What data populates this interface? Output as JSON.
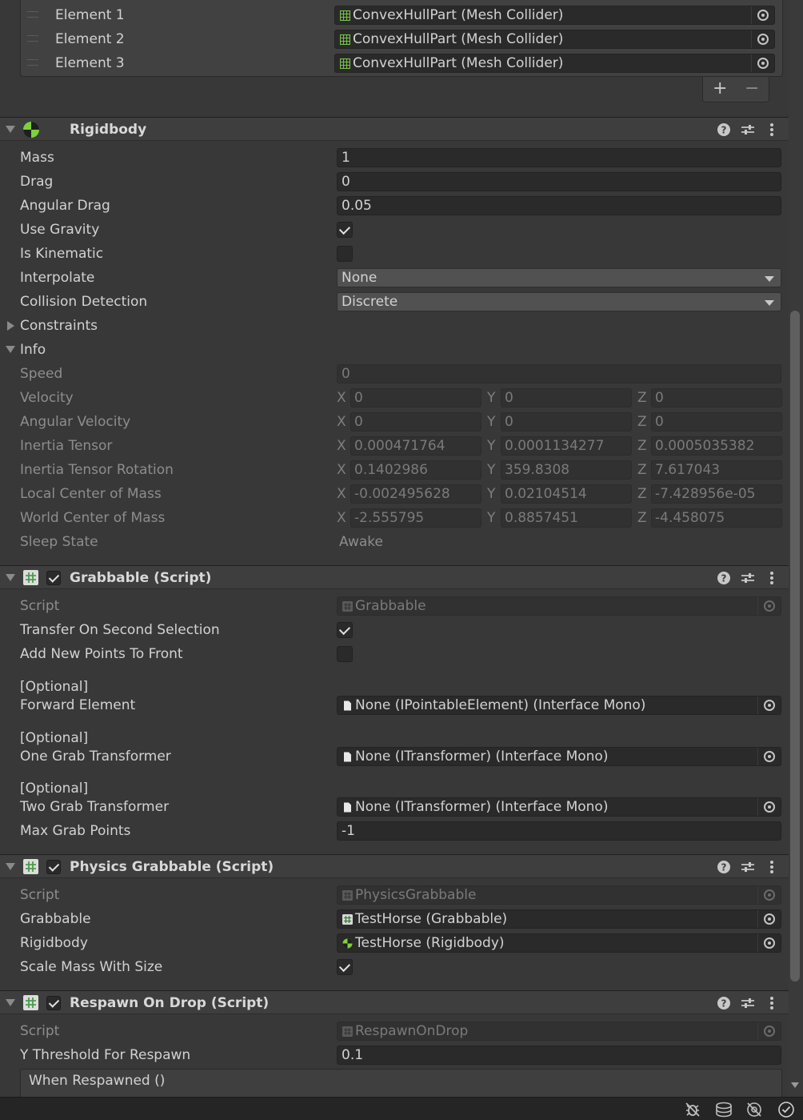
{
  "collider_list": {
    "elements": [
      {
        "label": "Element 1",
        "value": "ConvexHullPart (Mesh Collider)"
      },
      {
        "label": "Element 2",
        "value": "ConvexHullPart (Mesh Collider)"
      },
      {
        "label": "Element 3",
        "value": "ConvexHullPart (Mesh Collider)"
      }
    ],
    "add_label": "+",
    "remove_label": "−"
  },
  "rigidbody": {
    "title": "Rigidbody",
    "mass_label": "Mass",
    "mass": "1",
    "drag_label": "Drag",
    "drag": "0",
    "angular_drag_label": "Angular Drag",
    "angular_drag": "0.05",
    "use_gravity_label": "Use Gravity",
    "use_gravity": true,
    "is_kinematic_label": "Is Kinematic",
    "is_kinematic": false,
    "interpolate_label": "Interpolate",
    "interpolate": "None",
    "collision_label": "Collision Detection",
    "collision": "Discrete",
    "constraints_label": "Constraints",
    "info_label": "Info",
    "info": {
      "speed_label": "Speed",
      "speed": "0",
      "velocity_label": "Velocity",
      "velocity": {
        "x": "0",
        "y": "0",
        "z": "0"
      },
      "angular_velocity_label": "Angular Velocity",
      "angular_velocity": {
        "x": "0",
        "y": "0",
        "z": "0"
      },
      "inertia_tensor_label": "Inertia Tensor",
      "inertia_tensor": {
        "x": "0.000471764",
        "y": "0.0001134277",
        "z": "0.0005035382"
      },
      "inertia_rotation_label": "Inertia Tensor Rotation",
      "inertia_rotation": {
        "x": "0.1402986",
        "y": "359.8308",
        "z": "7.617043"
      },
      "local_com_label": "Local Center of Mass",
      "local_com": {
        "x": "-0.002495628",
        "y": "0.02104514",
        "z": "-7.428956e-05"
      },
      "world_com_label": "World Center of Mass",
      "world_com": {
        "x": "-2.555795",
        "y": "0.8857451",
        "z": "-4.458075"
      },
      "sleep_label": "Sleep State",
      "sleep": "Awake"
    }
  },
  "axis": {
    "x": "X",
    "y": "Y",
    "z": "Z"
  },
  "grabbable": {
    "title": "Grabbable (Script)",
    "script_label": "Script",
    "script": "Grabbable",
    "transfer_label": "Transfer On Second Selection",
    "transfer": true,
    "add_points_label": "Add New Points To Front",
    "add_points": false,
    "optional": "[Optional]",
    "forward_label": "Forward Element",
    "forward": "None (IPointableElement) (Interface Mono)",
    "one_grab_label": "One Grab Transformer",
    "one_grab": "None (ITransformer) (Interface Mono)",
    "two_grab_label": "Two Grab Transformer",
    "two_grab": "None (ITransformer) (Interface Mono)",
    "max_points_label": "Max Grab Points",
    "max_points": "-1"
  },
  "physics_grabbable": {
    "title": "Physics Grabbable (Script)",
    "script_label": "Script",
    "script": "PhysicsGrabbable",
    "grabbable_label": "Grabbable",
    "grabbable": "TestHorse (Grabbable)",
    "rigidbody_label": "Rigidbody",
    "rigidbody": "TestHorse (Rigidbody)",
    "scale_mass_label": "Scale Mass With Size",
    "scale_mass": true
  },
  "respawn": {
    "title": "Respawn On Drop (Script)",
    "script_label": "Script",
    "script": "RespawnOnDrop",
    "threshold_label": "Y Threshold For Respawn",
    "threshold": "0.1",
    "event_label": "When Respawned ()"
  },
  "colors": {
    "background": "#383838",
    "field": "#2a2a2a",
    "rigidbody_icon": "#7fd13a",
    "script_icon": "#5fb85f",
    "mesh_icon": "#79c24a"
  },
  "icons": [
    "mesh-collider-icon",
    "rigidbody-icon",
    "script-icon",
    "help-icon",
    "presets-icon",
    "kebab-menu-icon",
    "object-picker-icon",
    "debug-icon",
    "layers-icon",
    "visibility-icon",
    "checkmark-icon"
  ]
}
